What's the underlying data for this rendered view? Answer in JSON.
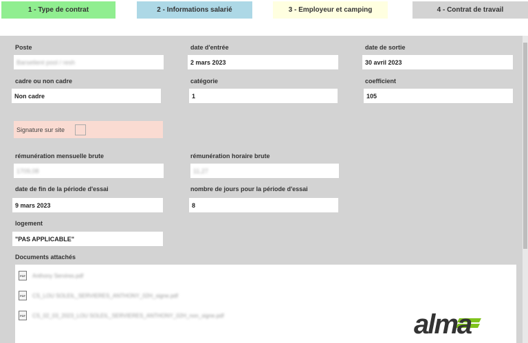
{
  "tabs": [
    "1 - Type de contrat",
    "2 - Informations salarié",
    "3 - Employeur et camping",
    "4 - Contrat de travail"
  ],
  "fields": {
    "poste": {
      "label": "Poste",
      "value": "Barsetlent pool / resh"
    },
    "date_entree": {
      "label": "date d'entrée",
      "value": "2 mars 2023"
    },
    "date_sortie": {
      "label": "date de sortie",
      "value": "30 avril 2023"
    },
    "cadre": {
      "label": "cadre ou non cadre",
      "value": "Non cadre"
    },
    "categorie": {
      "label": "catégorie",
      "value": "1"
    },
    "coefficient": {
      "label": "coefficient",
      "value": "105"
    },
    "remuneration_mensuelle": {
      "label": "rémunération mensuelle brute",
      "value": "1709,08"
    },
    "remuneration_horaire": {
      "label": "rémunération horaire brute",
      "value": "11,27"
    },
    "fin_essai": {
      "label": "date de fin de la période d'essai",
      "value": "9 mars 2023"
    },
    "jours_essai": {
      "label": "nombre de jours pour la période d'essai",
      "value": "8"
    },
    "logement": {
      "label": "logement",
      "value": "\"PAS APPLICABLE\""
    }
  },
  "signature": {
    "label": "Signature sur site",
    "checked": false
  },
  "documents": {
    "label": "Documents attachés",
    "files": [
      {
        "icon": "pdf-icon",
        "icon_text": "PDF",
        "name": "Anthony Servires.pdf"
      },
      {
        "icon": "pdf-icon",
        "icon_text": "PDF",
        "name": "CS_LOU SOLEIL_SERVIERES_ANTHONY_02H_signe.pdf"
      },
      {
        "icon": "pdf-icon",
        "icon_text": "PDF",
        "name": "CS_02_03_2023_LOU SOLEIL_SERVIERES_ANTHONY_02H_non_signe.pdf"
      }
    ]
  },
  "logo": {
    "text": "alma",
    "colors": {
      "dark": "#333333",
      "accent": "#7fc31c"
    }
  },
  "colors": {
    "tab1": "#90ee90",
    "tab2": "#add8e6",
    "tab3": "#ffffe0",
    "tab4": "#d3d3d3",
    "panel": "#d3d3d3",
    "signature_bg": "#fadbd2"
  }
}
